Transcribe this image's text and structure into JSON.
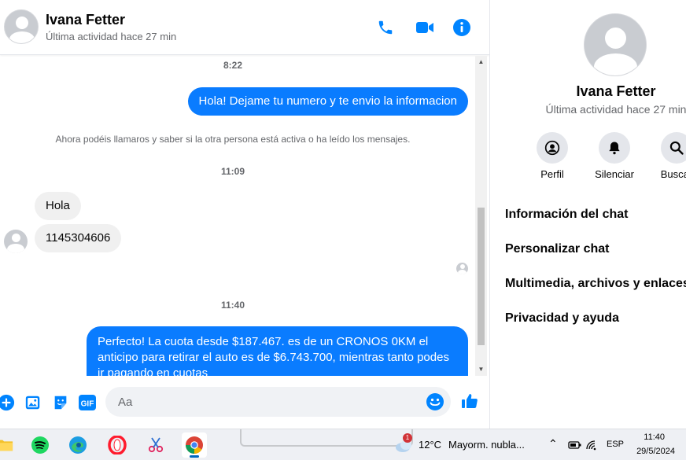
{
  "header": {
    "name": "Ivana Fetter",
    "status": "Última actividad hace 27 min"
  },
  "messages": {
    "time1": "8:22",
    "out1": "Hola! Dejame tu numero y te envio la informacion",
    "system": "Ahora podéis llamaros y saber si la otra persona está activa o ha leído los mensajes.",
    "time2": "11:09",
    "in1": "Hola",
    "in2": "1145304606",
    "time3": "11:40",
    "out2": "Perfecto! La cuota desde $187.467. es de un CRONOS 0KM el anticipo para retirar el auto es de $6.743.700, mientras tanto podes ir pagando en cuotas"
  },
  "composer": {
    "placeholder": "Aa"
  },
  "info": {
    "name": "Ivana Fetter",
    "status": "Última actividad hace 27 min",
    "actions": [
      "Perfil",
      "Silenciar",
      "Buscar"
    ],
    "menu": [
      "Información del chat",
      "Personalizar chat",
      "Multimedia, archivos y enlaces",
      "Privacidad y ayuda"
    ]
  },
  "taskbar": {
    "weather_temp": "12°C",
    "weather_desc": "Mayorm. nubla...",
    "weather_badge": "1",
    "lang": "ESP",
    "time": "11:40",
    "date": "29/5/2024"
  },
  "colors": {
    "accent": "#0a7cff",
    "icon_blue": "#0084ff"
  }
}
